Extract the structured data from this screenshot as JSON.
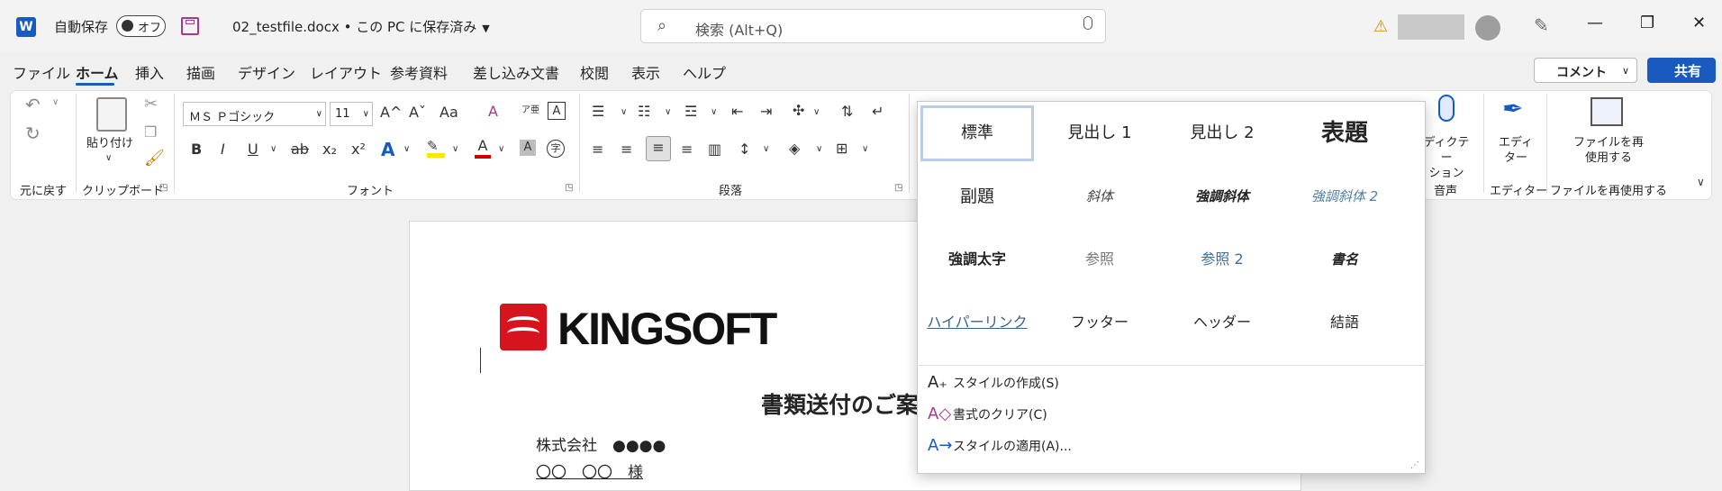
{
  "titlebar": {
    "app_icon": "word-logo",
    "app_letter": "W",
    "autosave_label": "自動保存",
    "autosave_state": "オフ",
    "filename": "02_testfile.docx • この PC に保存済み",
    "search_placeholder": "検索 (Alt+Q)",
    "window_controls": [
      "minimize",
      "restore",
      "close"
    ]
  },
  "tabs": [
    "ファイル",
    "ホーム",
    "挿入",
    "描画",
    "デザイン",
    "レイアウト",
    "参考資料",
    "差し込み文書",
    "校閲",
    "表示",
    "ヘルプ"
  ],
  "active_tab": "ホーム",
  "header_buttons": {
    "comment": "コメント",
    "share": "共有"
  },
  "ribbon": {
    "groups": [
      "元に戻す",
      "クリップボード",
      "フォント",
      "段落",
      "音声",
      "エディター",
      "ファイルを再使用する"
    ],
    "paste_label": "貼り付け",
    "font_name": "ＭＳ Ｐゴシック",
    "font_size": "11",
    "dictate_label": "ディクテー\nション",
    "editor_label": "エディ\nター",
    "reuse_label": "ファイルを再\n使用する",
    "font_btns": {
      "b": "B",
      "i": "I",
      "u": "U",
      "strike": "ab",
      "sub": "x₂",
      "sup": "x²",
      "grow": "A^",
      "shrink": "Aˇ",
      "case": "Aa",
      "clear": "A",
      "effects": "A",
      "highlight": "✎",
      "color": "A",
      "shade": "A",
      "enclose": "字"
    }
  },
  "document": {
    "logo_text": "KINGSOFT",
    "title": "書類送付のご案",
    "company": "株式会社　●●●●",
    "recipient": "〇〇　〇〇　様"
  },
  "style_gallery": {
    "styles": [
      "標準",
      "見出し 1",
      "見出し 2",
      "表題",
      "副題",
      "斜体",
      "強調斜体",
      "強調斜体 2",
      "強調太字",
      "参照",
      "参照 2",
      "書名",
      "ハイパーリンク",
      "フッター",
      "ヘッダー",
      "結語"
    ],
    "selected": "標準",
    "actions": [
      "スタイルの作成(S)",
      "書式のクリア(C)",
      "スタイルの適用(A)..."
    ]
  },
  "colors": {
    "accent": "#185abd",
    "highlight": "#ffe600",
    "font_color": "#d00000",
    "logo_red": "#d7141e"
  }
}
